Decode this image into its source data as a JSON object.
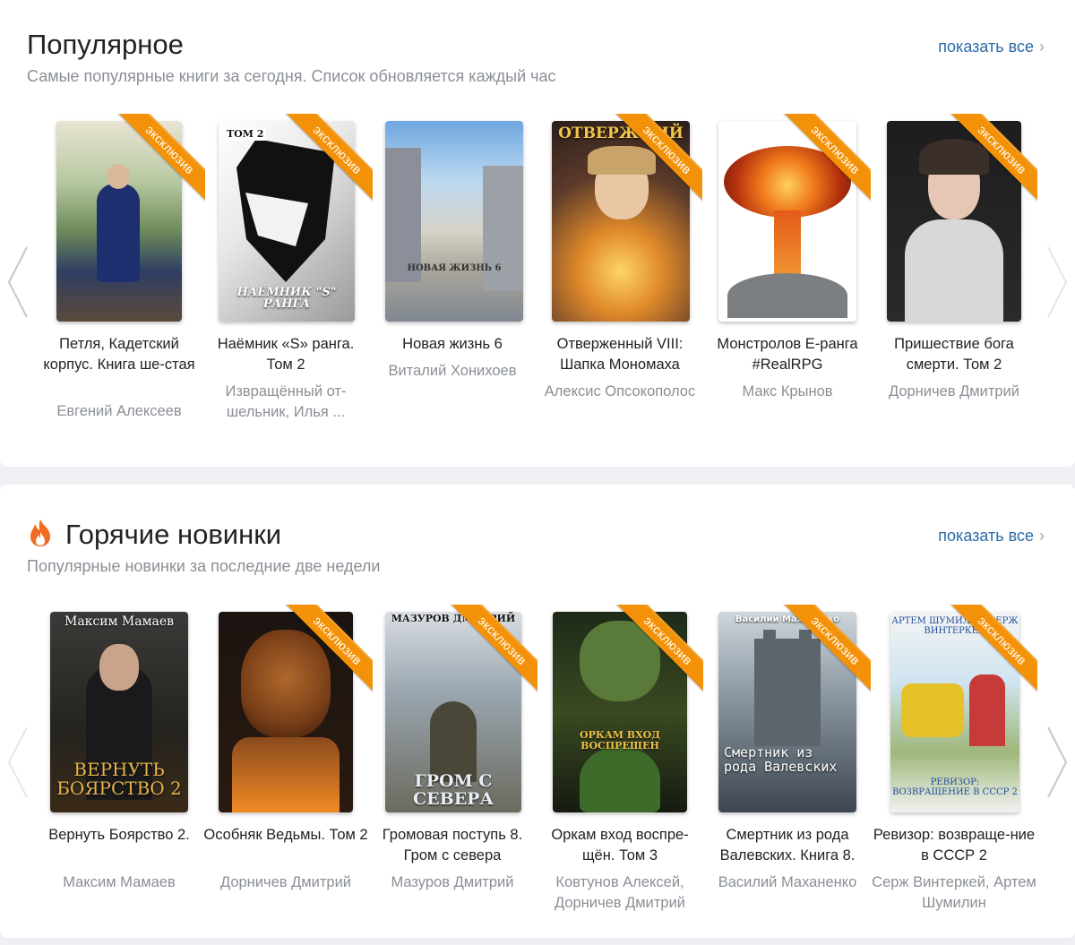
{
  "popular": {
    "title": "Популярное",
    "subtitle": "Самые популярные книги за сегодня. Список обновляется каждый час",
    "show_all": "показать все",
    "books": [
      {
        "title": "Петля, Кадетский корпус. Книга ше-стая",
        "author": "Евгений Алексеев",
        "badge": "эксклюзив",
        "cover_text": ""
      },
      {
        "title": "Наёмник «S» ранга. Том 2",
        "author": "Извращённый от-шельник, Илья ...",
        "badge": "эксклюзив",
        "cover_text": "НАЁМНИК \"S\" РАНГА",
        "cover_text2": "ТОМ 2"
      },
      {
        "title": "Новая жизнь 6",
        "author": "Виталий Хонихоев",
        "badge": "",
        "cover_text": "НОВАЯ ЖИЗНЬ 6"
      },
      {
        "title": "Отверженный VIII: Шапка Мономаха",
        "author": "Алексис Опсокополос",
        "badge": "эксклюзив",
        "cover_text": "ОТВЕРЖ...ИЙ"
      },
      {
        "title": "Монстролов E-ранга #RealRPG",
        "author": "Макс Крынов",
        "badge": "эксклюзив",
        "cover_text": ""
      },
      {
        "title": "Пришествие бога смерти. Том 2",
        "author": "Дорничев Дмитрий",
        "badge": "эксклюзив",
        "cover_text": ""
      }
    ]
  },
  "hot": {
    "title": "Горячие новинки",
    "subtitle": "Популярные новинки за последние две недели",
    "show_all": "показать все",
    "books": [
      {
        "title": "Вернуть Боярство 2.",
        "author": "Максим Мамаев",
        "badge": "",
        "cover_text": "ВЕРНУТЬ БОЯРСТВО 2",
        "cover_text2": "Максим Мамаев"
      },
      {
        "title": "Особняк Ведьмы. Том 2",
        "author": "Дорничев Дмитрий",
        "badge": "эксклюзив",
        "cover_text": ""
      },
      {
        "title": "Громовая поступь 8. Гром с севера",
        "author": "Мазуров Дмитрий",
        "badge": "эксклюзив",
        "cover_text": "ГРОМ С СЕВЕРА",
        "cover_text2": "МАЗУРОВ ДМИТРИЙ"
      },
      {
        "title": "Оркам вход воспре-щён. Том 3",
        "author": "Ковтунов Алексей, Дорничев Дмитрий",
        "badge": "эксклюзив",
        "cover_text": "ОРКАМ ВХОД ВОСПРЕЩЕН"
      },
      {
        "title": "Смертник из рода Валевских. Книга 8.",
        "author": "Василий Маханенко",
        "badge": "эксклюзив",
        "cover_text": "Смертник из рода Валевских",
        "cover_text2": "Василий Маханенко"
      },
      {
        "title": "Ревизор: возвраще-ние в СССР 2",
        "author": "Серж Винтеркей, Артем Шумилин",
        "badge": "эксклюзив",
        "cover_text": "РЕВИЗОР: ВОЗВРАЩЕНИЕ В СССР 2",
        "cover_text2": "АРТЕМ ШУМИЛИН СЕРЖ ВИНТЕРКЕЙ"
      }
    ]
  },
  "colors": {
    "accent": "#2b6ba8",
    "ribbon": "#f39208",
    "fire": "#f26b21"
  },
  "icons": {
    "prev": "chevron-left-icon",
    "next": "chevron-right-icon",
    "fire": "fire-icon"
  }
}
